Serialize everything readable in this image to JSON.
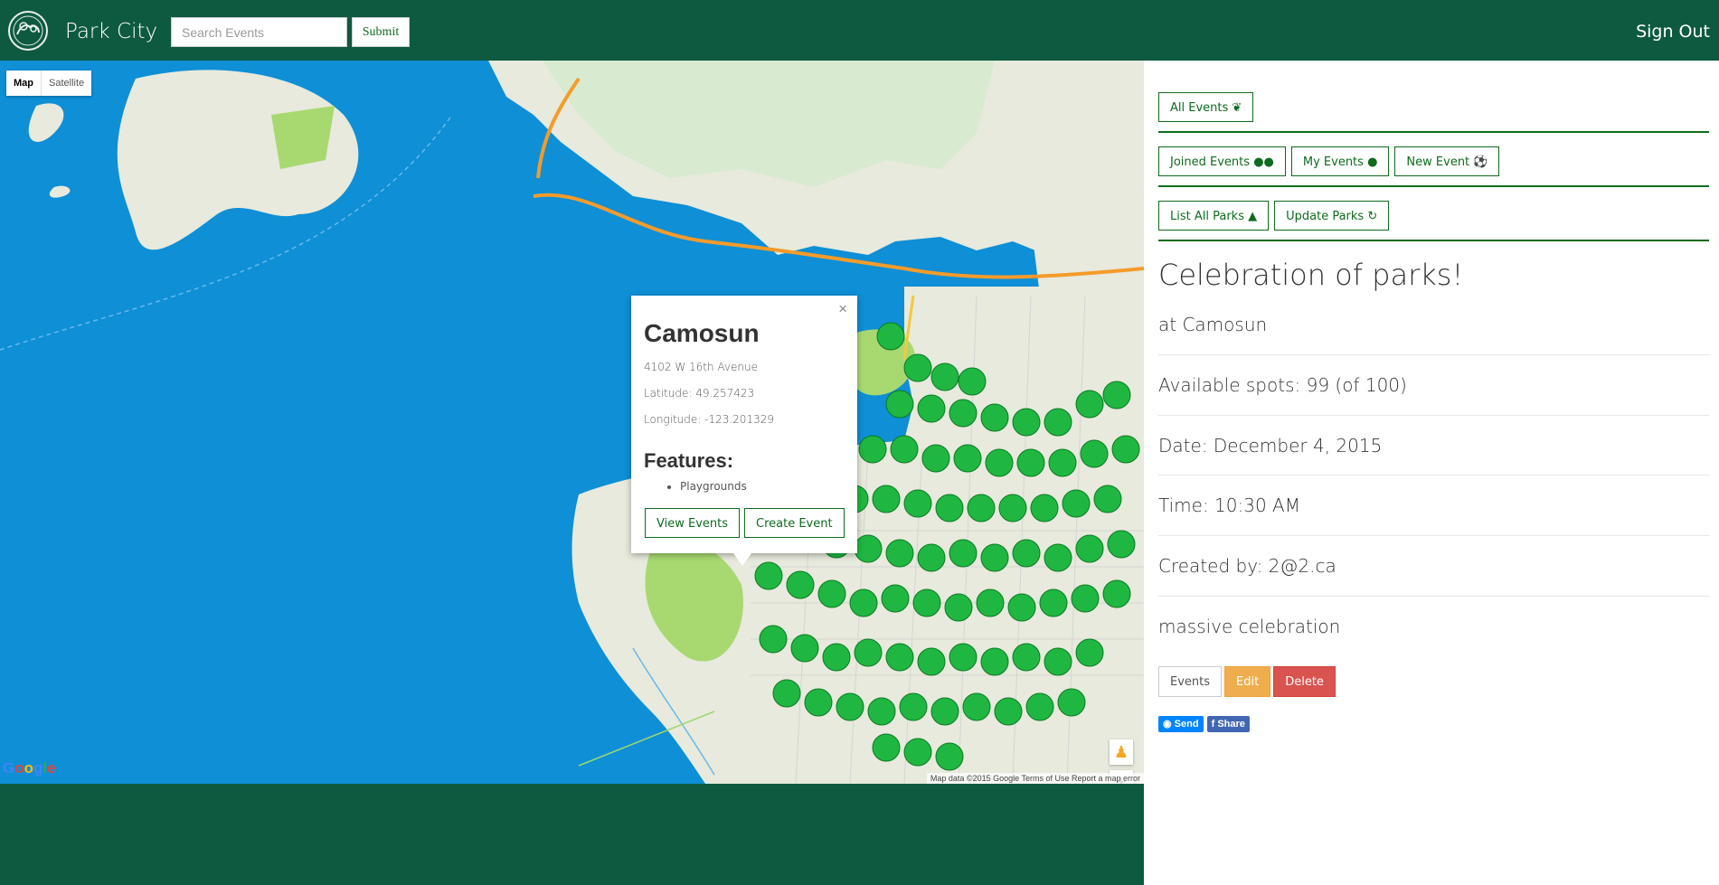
{
  "navbar": {
    "brand": "Park City",
    "search_placeholder": "Search Events",
    "submit_label": "Submit",
    "signout_label": "Sign Out",
    "background_color": "#0e5a40"
  },
  "map": {
    "type_controls": [
      "Map",
      "Satellite"
    ],
    "selected_type": "Map",
    "google_logo": "Google",
    "attribution": "Map data ©2015 Google   Terms of Use   Report a map error",
    "water_color": "#0e8fd6",
    "popup": {
      "close_glyph": "×",
      "park_name": "Camosun",
      "address": "4102 W 16th Avenue",
      "latitude": "Latitude: 49.257423",
      "longitude": "Longitude: -123.201329",
      "features_title": "Features:",
      "features": [
        "Playgrounds"
      ],
      "view_events_label": "View Events",
      "create_event_label": "Create Event"
    },
    "zoom_in": "+",
    "zoom_out": "−",
    "pegman_icon": "pegman-icon"
  },
  "panel": {
    "buttons_row1": [
      {
        "label": "All Events",
        "icon": "leaf-icon"
      }
    ],
    "buttons_row2": [
      {
        "label": "Joined Events",
        "icon": "users-icon"
      },
      {
        "label": "My Events",
        "icon": "user-icon"
      },
      {
        "label": "New Event",
        "icon": "soccer-ball-icon"
      }
    ],
    "buttons_row3": [
      {
        "label": "List All Parks",
        "icon": "tree-icon"
      },
      {
        "label": "Update Parks",
        "icon": "refresh-icon"
      }
    ],
    "event": {
      "title": "Celebration of parks!",
      "location": "at Camosun",
      "spots": "Available spots: 99 (of 100)",
      "date": "Date: December 4, 2015",
      "time": "Time: 10:30 AM",
      "created_by": "Created by: 2@2.ca",
      "description": "massive celebration"
    },
    "actions": {
      "events_label": "Events",
      "edit_label": "Edit",
      "delete_label": "Delete"
    },
    "share": {
      "send_label": "Send",
      "share_label": "Share"
    },
    "accent_color": "#0e6b1e"
  }
}
